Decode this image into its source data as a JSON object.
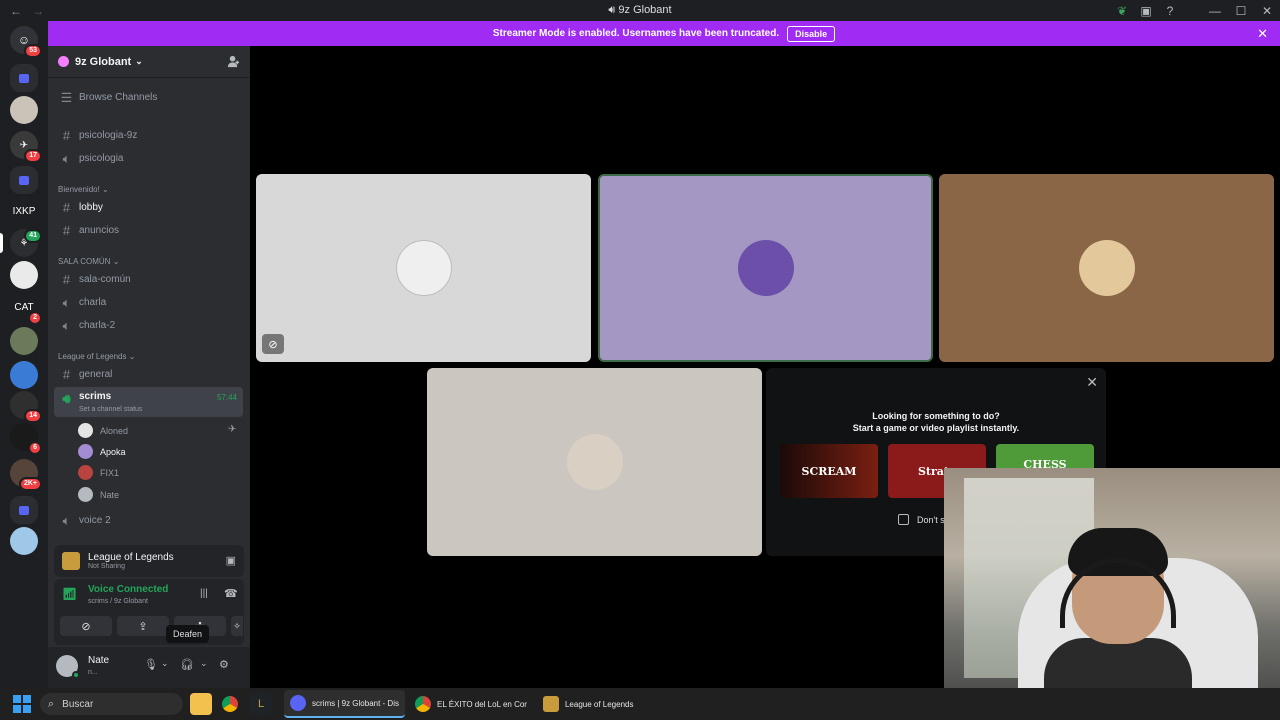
{
  "titlebar": {
    "title": "9z Globant"
  },
  "streamer_banner": {
    "text": "Streamer Mode is enabled. Usernames have been truncated.",
    "button": "Disable"
  },
  "guilds": [
    {
      "label": "",
      "badge": "53",
      "kind": "discord"
    },
    {
      "label": "",
      "badge": "",
      "kind": "folder"
    },
    {
      "label": "",
      "badge": "",
      "kind": "image"
    },
    {
      "label": "",
      "badge": "17",
      "kind": "image"
    },
    {
      "label": "",
      "badge": "",
      "kind": "folder"
    },
    {
      "label": "IXKP",
      "badge": "",
      "kind": "text"
    },
    {
      "label": "",
      "badge": "41",
      "kind": "image"
    },
    {
      "label": "",
      "badge": "",
      "kind": "image"
    },
    {
      "label": "CAT",
      "badge": "2",
      "kind": "text"
    },
    {
      "label": "",
      "badge": "",
      "kind": "image"
    },
    {
      "label": "",
      "badge": "",
      "kind": "image"
    },
    {
      "label": "",
      "badge": "14",
      "kind": "image"
    },
    {
      "label": "",
      "badge": "6",
      "kind": "image"
    },
    {
      "label": "",
      "badge": "2K+",
      "kind": "image"
    },
    {
      "label": "",
      "badge": "",
      "kind": "folder"
    }
  ],
  "server": {
    "name": "9z Globant"
  },
  "channels": {
    "browse": "Browse Channels",
    "psicologia_text": "psicologia-9z",
    "psicologia_voice": "psicologia",
    "cat_bienvenido": "Bienvenido!",
    "lobby": "lobby",
    "anuncios": "anuncios",
    "cat_sala": "SALA COMÚN",
    "sala_comun": "sala-común",
    "charla": "charla",
    "charla2": "charla-2",
    "cat_lol": "League of Legends",
    "general": "general",
    "scrims": "scrims",
    "scrims_timer": "57:44",
    "scrims_status": "Set a channel status",
    "voice_users": [
      "Aloned",
      "Apoka",
      "FIX1",
      "Nate"
    ],
    "voice2": "voice 2"
  },
  "activity_panel": {
    "title": "League of Legends",
    "subtitle": "Not Sharing"
  },
  "voice_panel": {
    "status": "Voice Connected",
    "location": "scrims / 9z Globant"
  },
  "user_panel": {
    "name": "Nate",
    "status": "n..."
  },
  "tooltip": "Deafen",
  "activity_card": {
    "line1": "Looking for something to do?",
    "line2": "Start a game or video playlist instantly.",
    "games": [
      "SCREAM",
      "Strate",
      "CHESS"
    ],
    "dont_show": "Don't sh"
  },
  "taskbar": {
    "search": "Buscar",
    "windows": [
      "scrims | 9z Globant - Dis",
      "EL ÉXITO del LoL en Cor",
      "League of Legends"
    ]
  },
  "colors": {
    "accent": "#a02cf4",
    "voice_green": "#23a55a",
    "tile1": "#d8d8d8",
    "tile2": "#a497c3",
    "tile3": "#8a6646",
    "tile4": "#cbc6c0"
  }
}
